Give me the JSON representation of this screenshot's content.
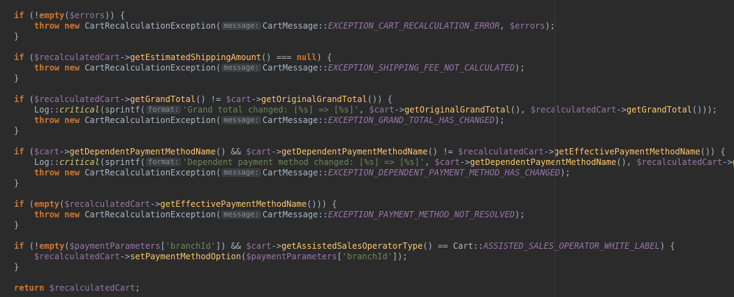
{
  "code": {
    "keywords": {
      "if": "if",
      "throw": "throw",
      "new": "new",
      "empty": "empty",
      "null": "null",
      "return": "return"
    },
    "vars": {
      "errors": "$errors",
      "recalculatedCart": "$recalculatedCart",
      "cart": "$cart",
      "paymentParameters": "$paymentParameters"
    },
    "classes": {
      "exception": "CartRecalculationException",
      "message": "CartMessage",
      "log": "Log",
      "cart": "Cart"
    },
    "methods": {
      "getEstimatedShippingAmount": "getEstimatedShippingAmount",
      "getGrandTotal": "getGrandTotal",
      "getOriginalGrandTotal": "getOriginalGrandTotal",
      "getDependentPaymentMethodName": "getDependentPaymentMethodName",
      "getEffectivePaymentMethodName": "getEffectivePaymentMethodName",
      "getAssistedSalesOperatorType": "getAssistedSalesOperatorType",
      "setPaymentMethodOption": "setPaymentMethodOption",
      "critical": "critical",
      "sprintf": "sprintf",
      "getEf": "getEf"
    },
    "constants": {
      "recalcError": "EXCEPTION_CART_RECALCULATION_ERROR",
      "shippingFee": "EXCEPTION_SHIPPING_FEE_NOT_CALCULATED",
      "grandTotal": "EXCEPTION_GRAND_TOTAL_HAS_CHANGED",
      "dependentPayment": "EXCEPTION_DEPENDENT_PAYMENT_METHOD_HAS_CHANGED",
      "paymentNotResolved": "EXCEPTION_PAYMENT_METHOD_NOT_RESOLVED",
      "assistedWhiteLabel": "ASSISTED_SALES_OPERATOR_WHITE_LABEL"
    },
    "strings": {
      "grandTotalChanged": "'Grand total changed: [%s] => [%s]'",
      "dependentChanged": "'Dependent payment method changed: [%s] => [%s]'",
      "branchId": "'branchId'"
    },
    "hints": {
      "message": "message:",
      "format": "format:"
    }
  }
}
